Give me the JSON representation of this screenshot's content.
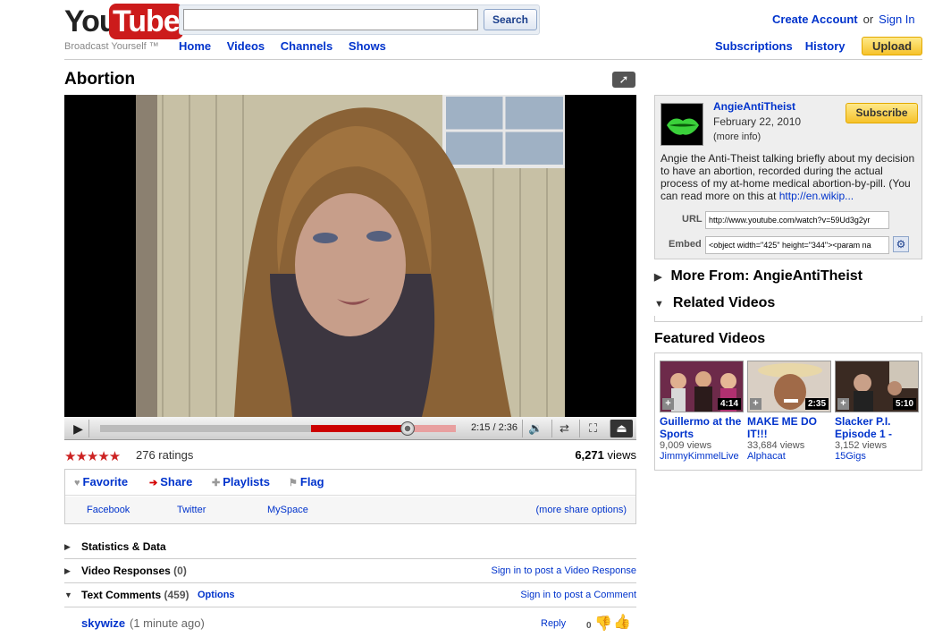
{
  "header": {
    "logo_you": "You",
    "logo_tube": "Tube",
    "tagline": "Broadcast Yourself ™",
    "search": {
      "value": "",
      "button": "Search"
    },
    "nav": [
      "Home",
      "Videos",
      "Channels",
      "Shows"
    ],
    "create_account": "Create Account",
    "or": "or",
    "sign_in": "Sign In",
    "subscriptions": "Subscriptions",
    "history": "History",
    "upload": "Upload"
  },
  "video": {
    "title": "Abortion",
    "time": "2:15 / 2:36",
    "progress_fraction": 0.865,
    "ratings_text": "276 ratings",
    "stars": "★★★★★",
    "views_count": "6,271",
    "views_label": "views"
  },
  "actions": {
    "favorite": "Favorite",
    "share": "Share",
    "playlists": "Playlists",
    "flag": "Flag",
    "facebook": "Facebook",
    "twitter": "Twitter",
    "myspace": "MySpace",
    "more_share": "(more share options)"
  },
  "sections": {
    "stats": "Statistics & Data",
    "responses_label": "Video Responses",
    "responses_count": "(0)",
    "responses_link": "Sign in to post a Video Response",
    "comments_label": "Text Comments",
    "comments_count": "(459)",
    "comments_options": "Options",
    "comments_link": "Sign in to post a Comment"
  },
  "comment": {
    "user": "skywize",
    "time": "(1 minute ago)",
    "reply": "Reply",
    "score": "0"
  },
  "uploader": {
    "name": "AngieAntiTheist",
    "date": "February 22, 2010",
    "more_info": "(more info)",
    "subscribe": "Subscribe",
    "description": "Angie the Anti-Theist talking briefly about my decision to have an abortion, recorded during the actual process of my at-home medical abortion-by-pill. (You can read more on this at ",
    "description_link": "http://en.wikip...",
    "url_label": "URL",
    "url_value": "http://www.youtube.com/watch?v=59Ud3g2yr",
    "embed_label": "Embed",
    "embed_value": "<object width=\"425\" height=\"344\"><param na"
  },
  "sidebar": {
    "more_from": "More From: AngieAntiTheist",
    "related": "Related Videos",
    "featured_title": "Featured Videos",
    "featured": [
      {
        "title": "Guillermo at the Sports",
        "duration": "4:14",
        "views": "9,009 views",
        "user": "JimmyKimmelLive"
      },
      {
        "title": "MAKE ME DO IT!!!",
        "duration": "2:35",
        "views": "33,684 views",
        "user": "Alphacat"
      },
      {
        "title": "Slacker P.I. Episode 1 -",
        "duration": "5:10",
        "views": "3,152 views",
        "user": "15Gigs"
      }
    ]
  }
}
